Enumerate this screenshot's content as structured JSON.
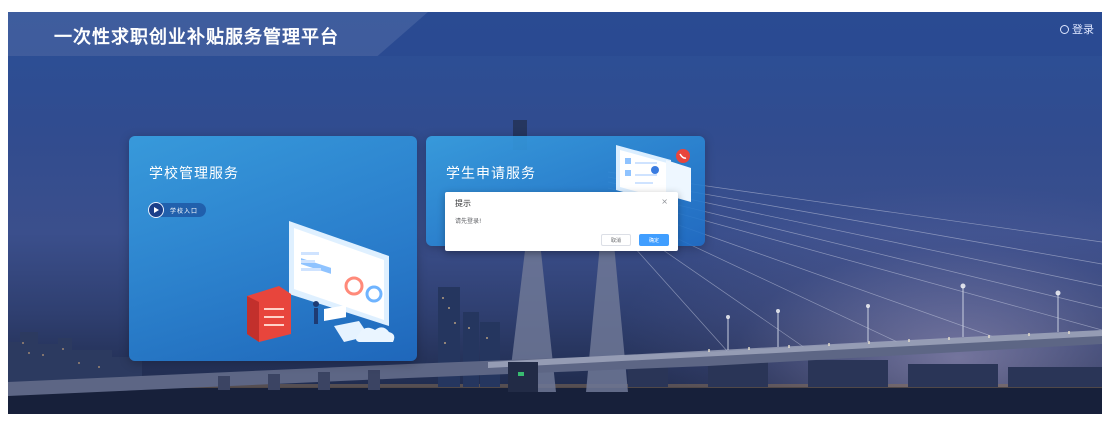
{
  "header": {
    "title": "一次性求职创业补贴服务管理平台",
    "login_label": "登录"
  },
  "cards": {
    "school": {
      "title": "学校管理服务",
      "entry_label": "学校入口"
    },
    "student": {
      "title": "学生申请服务"
    }
  },
  "dialog": {
    "title": "提示",
    "close_glyph": "×",
    "message": "请先登录!",
    "cancel_label": "取消",
    "confirm_label": "确定"
  },
  "colors": {
    "primary": "#409eff",
    "card_blue": "#2f8fd8",
    "background": "#2f4a8c"
  }
}
